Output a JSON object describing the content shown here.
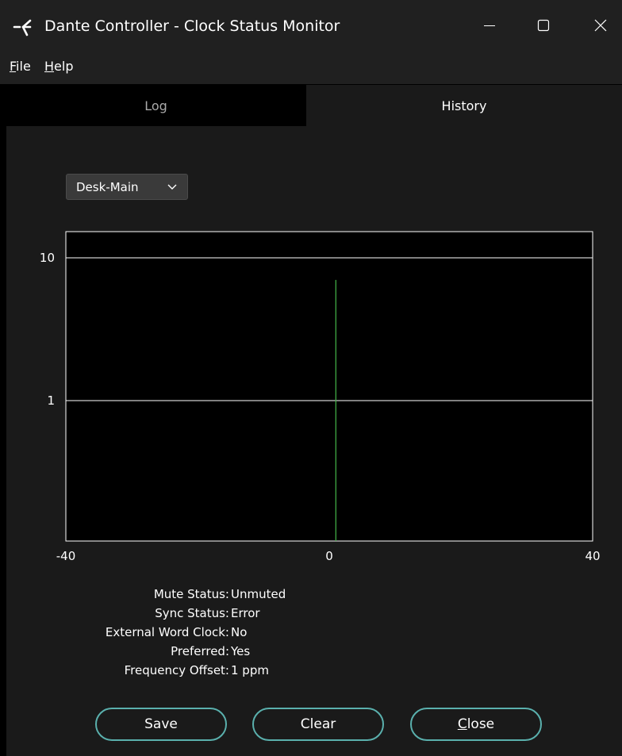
{
  "window": {
    "title": "Dante Controller - Clock Status Monitor",
    "icon": "dante-icon",
    "controls": [
      "minimize-icon",
      "maximize-icon",
      "close-icon"
    ]
  },
  "menu": {
    "file": {
      "mnemonic": "F",
      "rest": "ile"
    },
    "help": {
      "mnemonic": "H",
      "rest": "elp"
    }
  },
  "tabs": [
    {
      "label": "Log",
      "selected": false
    },
    {
      "label": "History",
      "selected": true
    }
  ],
  "device_select": {
    "value": "Desk-Main",
    "icon": "chevron-down-icon"
  },
  "chart_data": {
    "type": "line",
    "title": "",
    "xlabel": "",
    "ylabel": "",
    "xlim": [
      -40,
      40
    ],
    "x_ticks": [
      "-40",
      "0",
      "40"
    ],
    "y_scale": "log",
    "y_ticks": [
      "10",
      "1"
    ],
    "gridlines_y": [
      10,
      1
    ],
    "grid": true,
    "series": [
      {
        "color": "#46b84a",
        "points": [
          {
            "x": 1,
            "y": 7
          }
        ]
      }
    ]
  },
  "status": [
    {
      "label": "Mute Status:",
      "value": "Unmuted"
    },
    {
      "label": "Sync Status:",
      "value": "Error"
    },
    {
      "label": "External Word Clock:",
      "value": "No"
    },
    {
      "label": "Preferred:",
      "value": "Yes"
    },
    {
      "label": "Frequency Offset:",
      "value": "1 ppm"
    }
  ],
  "buttons": {
    "save": {
      "label": "Save"
    },
    "clear": {
      "label": "Clear"
    },
    "close": {
      "mnemonic": "C",
      "rest": "lose"
    }
  },
  "colors": {
    "accent": "#5ab0ad",
    "series": "#46b84a",
    "background": "#1a1a1a"
  }
}
